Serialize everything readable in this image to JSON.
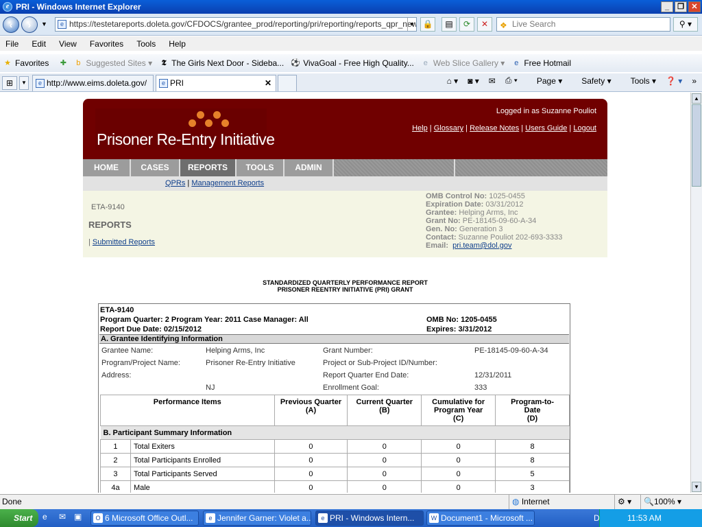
{
  "window": {
    "title": "PRI - Windows Internet Explorer"
  },
  "address": {
    "url": "https://testetareports.doleta.gov/CFDOCS/grantee_prod/reporting/pri/reporting/reports_qpr_new.c",
    "search_placeholder": "Live Search"
  },
  "menu": [
    "File",
    "Edit",
    "View",
    "Favorites",
    "Tools",
    "Help"
  ],
  "favorites": {
    "label": "Favorites",
    "items": [
      "Suggested Sites",
      "The Girls Next Door - Sideba...",
      "VivaGoal - Free High Quality...",
      "Web Slice Gallery",
      "Free Hotmail"
    ]
  },
  "tabs": [
    {
      "label": "http://www.eims.doleta.gov/"
    },
    {
      "label": "PRI"
    }
  ],
  "commands": [
    "Page",
    "Safety",
    "Tools"
  ],
  "page": {
    "brand": "Prisoner Re-Entry Initiative",
    "logged_in": "Logged in as Suzanne Pouliot",
    "links": [
      "Help",
      "Glossary",
      "Release Notes",
      "Users Guide",
      "Logout"
    ],
    "nav": [
      "HOME",
      "CASES",
      "REPORTS",
      "TOOLS",
      "ADMIN"
    ],
    "subnav": [
      "QPRs",
      "Management Reports"
    ],
    "form_id": "ETA-9140",
    "section_title": "REPORTS",
    "submitted_reports": "Submitted Reports",
    "meta": {
      "omb_label": "OMB Control No:",
      "omb": "1025-0455",
      "exp_label": "Expiration Date:",
      "exp": "03/31/2012",
      "grantee_label": "Grantee:",
      "grantee": "Helping Arms, Inc",
      "grant_label": "Grant No:",
      "grant": "PE-18145-09-60-A-34",
      "gen_label": "Gen. No:",
      "gen": "Generation 3",
      "contact_label": "Contact:",
      "contact": "Suzanne Pouliot  202-693-3333",
      "email_label": "Email:",
      "email": "pri.team@dol.gov"
    },
    "report_title_1": "STANDARDIZED QUARTERLY PERFORMANCE REPORT",
    "report_title_2": "PRISONER REENTRY INITIATIVE (PRI) GRANT",
    "report": {
      "form": "ETA-9140",
      "quarter_line": "Program Quarter: 2 Program Year: 2011 Case Manager: All",
      "omb_no": "OMB No: 1205-0455",
      "due": "Report Due Date: 02/15/2012",
      "expires": "Expires: 3/31/2012",
      "section_a": "A. Grantee Identifying Information",
      "grantee_name_label": "Grantee Name:",
      "grantee_name": "Helping Arms, Inc",
      "program_label": "Program/Project Name:",
      "program": "Prisoner Re-Entry Initiative",
      "address_label": "Address:",
      "state": "NJ",
      "grant_number_label": "Grant Number:",
      "grant_number": "PE-18145-09-60-A-34",
      "subproject_label": "Project or Sub-Project ID/Number:",
      "quarter_end_label": "Report Quarter End Date:",
      "quarter_end": "12/31/2011",
      "goal_label": "Enrollment Goal:",
      "goal": "333",
      "columns": {
        "item": "Performance Items",
        "a1": "Previous Quarter",
        "a2": "(A)",
        "b1": "Current Quarter",
        "b2": "(B)",
        "c1": "Cumulative for",
        "c2": "Program Year",
        "c3": "(C)",
        "d1": "Program-to-",
        "d2": "Date",
        "d3": "(D)"
      },
      "section_b": "B. Participant Summary Information",
      "rows": [
        {
          "num": "1",
          "label": "Total Exiters",
          "a": "0",
          "b": "0",
          "c": "0",
          "d": "8"
        },
        {
          "num": "2",
          "label": "Total Participants Enrolled",
          "a": "0",
          "b": "0",
          "c": "0",
          "d": "8"
        },
        {
          "num": "3",
          "label": "Total Participants Served",
          "a": "0",
          "b": "0",
          "c": "0",
          "d": "5"
        },
        {
          "num": "4a",
          "label": "Male",
          "a": "0",
          "b": "0",
          "c": "0",
          "d": "3"
        }
      ]
    }
  },
  "status": {
    "text": "Done",
    "zone": "Internet",
    "zoom": "100%"
  },
  "taskbar": {
    "start": "Start",
    "items": [
      "6 Microsoft Office Outl...",
      "Jennifer Garner: Violet a...",
      "PRI - Windows Intern...",
      "Document1 - Microsoft ..."
    ],
    "desktop": "Desktop",
    "time": "11:53 AM"
  }
}
